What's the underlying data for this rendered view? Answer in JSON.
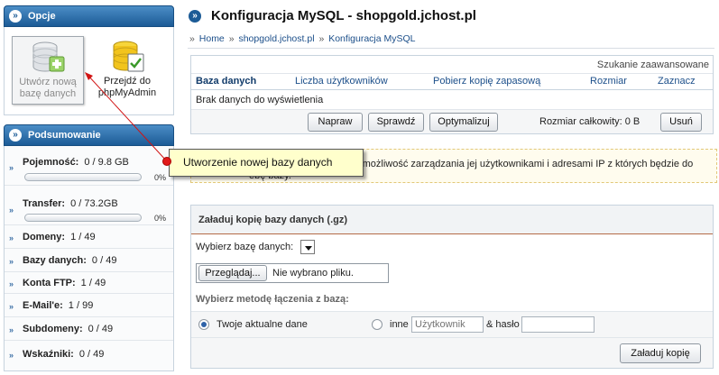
{
  "sidebar": {
    "options": {
      "title": "Opcje",
      "create_db": "Utwórz nową bazę danych",
      "phpmyadmin": "Przejdź do phpMyAdmin"
    },
    "summary": {
      "title": "Podsumowanie",
      "rows": [
        {
          "label": "Pojemność:",
          "value": "0 / 9.8 GB",
          "percent": "0%",
          "fill": 0
        },
        {
          "label": "Transfer:",
          "value": "0 / 73.2GB",
          "percent": "0%",
          "fill": 0
        },
        {
          "label": "Domeny:",
          "value": "1 / 49"
        },
        {
          "label": "Bazy danych:",
          "value": "0 / 49"
        },
        {
          "label": "Konta FTP:",
          "value": "1 / 49"
        },
        {
          "label": "E-Mail'e:",
          "value": "1 / 99"
        },
        {
          "label": "Subdomeny:",
          "value": "0 / 49"
        },
        {
          "label": "Wskaźniki:",
          "value": "0 / 49"
        }
      ]
    }
  },
  "main": {
    "title": "Konfiguracja MySQL - shopgold.jchost.pl",
    "breadcrumb": {
      "home": "Home",
      "domain": "shopgold.jchost.pl",
      "current": "Konfiguracja MySQL",
      "sep": "»"
    },
    "db_table": {
      "advanced_search": "Szukanie zaawansowane",
      "columns": [
        "Baza danych",
        "Liczba użytkowników",
        "Pobierz kopię zapasową",
        "Rozmiar",
        "Zaznacz"
      ],
      "empty": "Brak danych do wyświetlenia",
      "repair": "Napraw",
      "check": "Sprawdź",
      "optimize": "Optymalizuj",
      "total_size": "Rozmiar całkowity: 0 B",
      "delete": "Usuń"
    },
    "info": {
      "text": "ał możliwość zarządzania jej użytkownikami i adresami IP z których będzie do",
      "text2": "ebę bazy."
    },
    "upload": {
      "title": "Załaduj kopię bazy danych (.gz)",
      "select_label": "Wybierz bazę danych:",
      "browse": "Przeglądaj...",
      "no_file": "Nie wybrano pliku.",
      "method_title": "Wybierz metodę łączenia z bazą:",
      "opt_current": "Twoje aktualne dane",
      "opt_other": "inne",
      "user_placeholder": "Użytkownik",
      "password_label": "& hasło",
      "submit": "Załaduj kopię"
    }
  },
  "tooltip": {
    "text": "Utworzenie nowej bazy danych"
  },
  "colors": {
    "header_blue": "#1c5b96",
    "link": "#1c4f8a",
    "tooltip_bg": "#ffffcc",
    "callout_red": "#e11919"
  }
}
